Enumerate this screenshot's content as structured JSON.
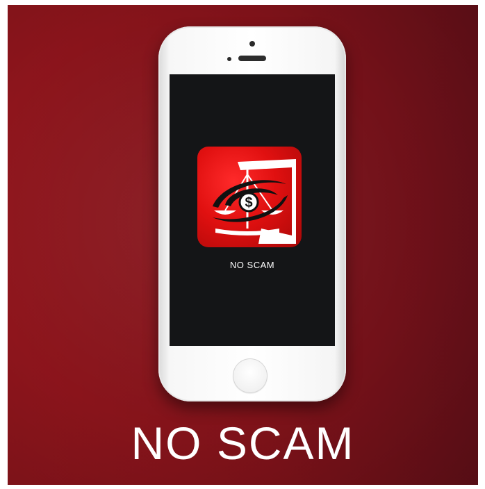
{
  "app": {
    "label": "NO SCAM",
    "icon_name": "scale-dollar-logo-icon"
  },
  "headline": "NO SCAM",
  "colors": {
    "background": "#8e151c",
    "icon_red": "#e01010",
    "screen": "#141517",
    "phone_body": "#ffffff"
  }
}
